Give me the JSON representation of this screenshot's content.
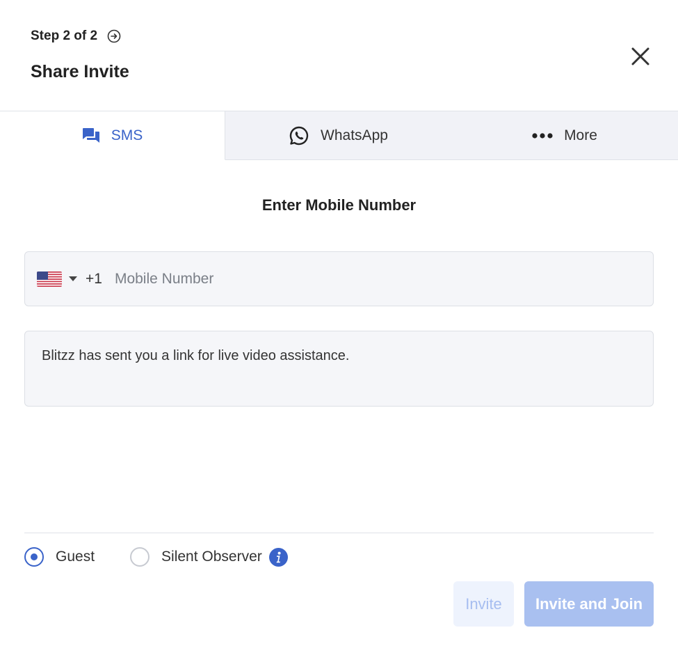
{
  "header": {
    "step_label": "Step 2 of 2",
    "title": "Share Invite",
    "step_icon": "arrow-circle-right-icon",
    "close_icon": "close-icon"
  },
  "tabs": [
    {
      "label": "SMS",
      "icon": "chat-bubbles-icon",
      "active": true
    },
    {
      "label": "WhatsApp",
      "icon": "whatsapp-icon",
      "active": false
    },
    {
      "label": "More",
      "icon": "more-dots-icon",
      "active": false
    }
  ],
  "form": {
    "section_title": "Enter Mobile Number",
    "country_flag": "us-flag-icon",
    "dial_code": "+1",
    "phone_placeholder": "Mobile Number",
    "phone_value": "",
    "message": "Blitzz has sent you a link for live video assistance."
  },
  "role": {
    "options": [
      {
        "label": "Guest",
        "selected": true
      },
      {
        "label": "Silent Observer",
        "selected": false
      }
    ],
    "info_icon": "info-icon"
  },
  "actions": {
    "invite_label": "Invite",
    "invite_join_label": "Invite and Join"
  },
  "colors": {
    "accent": "#3a63c9",
    "tab_inactive_bg": "#f1f2f7",
    "button_disabled_bg": "#a9c0f0",
    "button_light_bg": "#eef3fd"
  }
}
